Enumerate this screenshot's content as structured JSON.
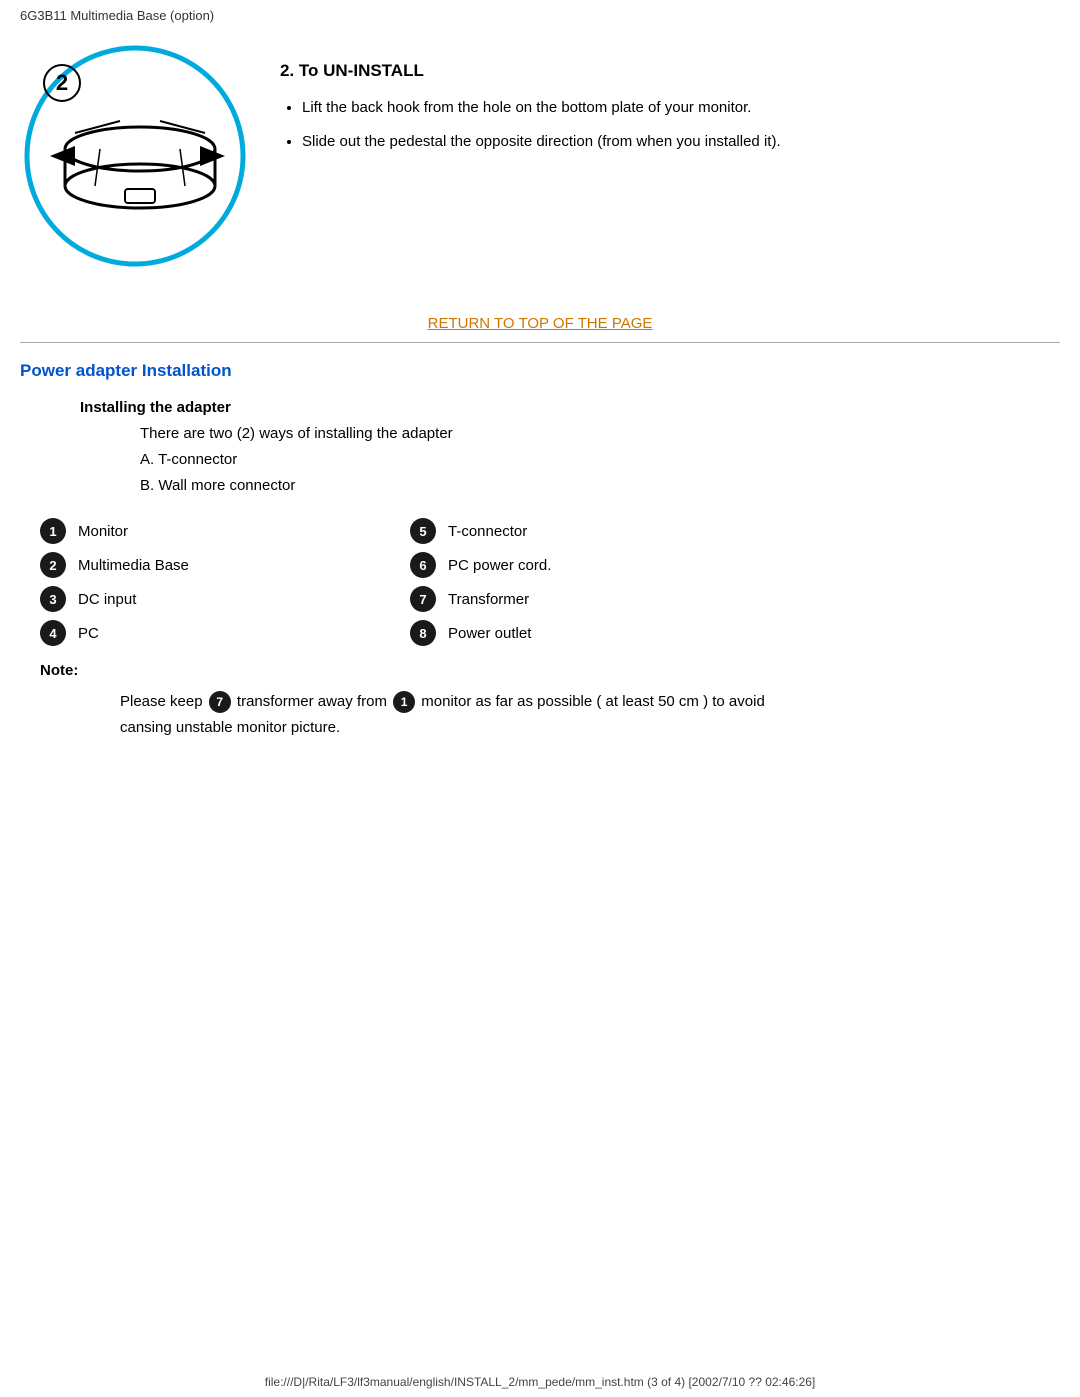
{
  "header": {
    "title": "6G3B11 Multimedia Base (option)"
  },
  "uninstall": {
    "section_title": "2. To UN-INSTALL",
    "bullet1": "Lift the back hook from the hole on the bottom plate of your monitor.",
    "bullet2": "Slide out the pedestal the opposite direction (from when you installed it)."
  },
  "return_link": "RETURN TO TOP OF THE PAGE",
  "power_adapter": {
    "section_title": "Power adapter Installation",
    "sub_title": "Installing the adapter",
    "desc1": "There are two (2) ways of installing the adapter",
    "desc2": "A. T-connector",
    "desc3": "B. Wall more connector",
    "items": [
      {
        "num": "1",
        "label": "Monitor"
      },
      {
        "num": "2",
        "label": "Multimedia Base"
      },
      {
        "num": "3",
        "label": "DC input"
      },
      {
        "num": "4",
        "label": "PC"
      },
      {
        "num": "5",
        "label": "T-connector"
      },
      {
        "num": "6",
        "label": "PC power cord."
      },
      {
        "num": "7",
        "label": "Transformer"
      },
      {
        "num": "8",
        "label": "Power outlet"
      }
    ],
    "note_label": "Note:",
    "note_text_before": "Please keep",
    "note_badge7": "7",
    "note_text_mid": "transformer away from",
    "note_badge1": "1",
    "note_text_after": "monitor as far as possible ( at least 50 cm ) to avoid cansing unstable monitor picture."
  },
  "footer": {
    "text": "file:///D|/Rita/LF3/lf3manual/english/INSTALL_2/mm_pede/mm_inst.htm (3 of 4) [2002/7/10 ?? 02:46:26]"
  }
}
